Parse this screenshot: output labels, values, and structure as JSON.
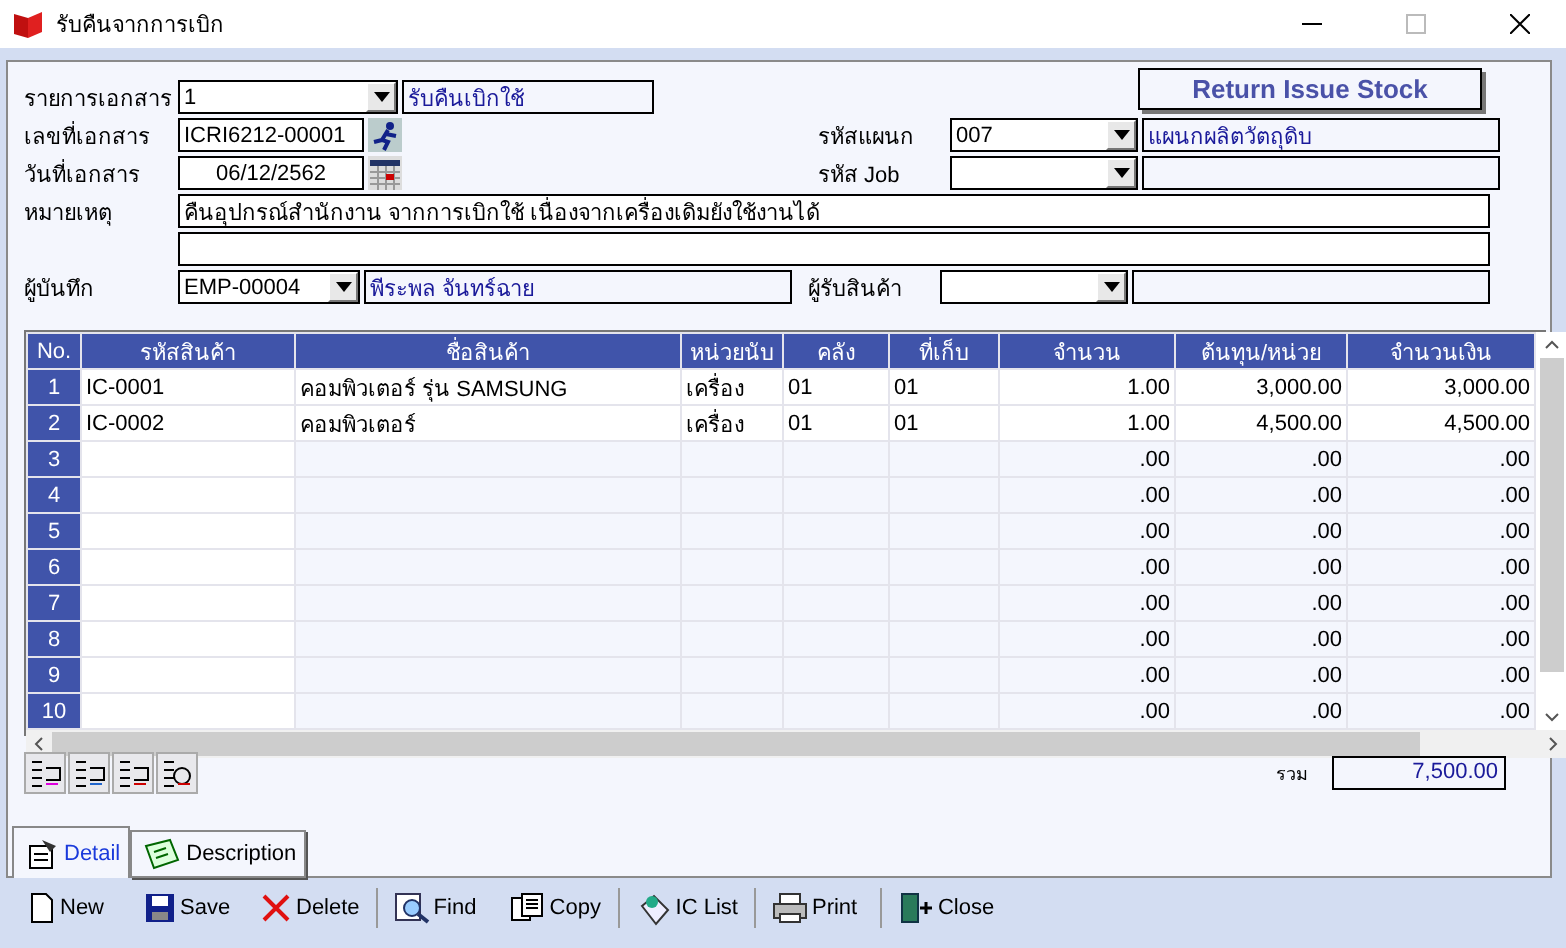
{
  "window": {
    "title": "รับคืนจากการเบิก"
  },
  "header_button": "Return Issue Stock",
  "form": {
    "doc_type": {
      "label": "รายการเอกสาร",
      "value": "1",
      "description": "รับคืนเบิกใช้"
    },
    "doc_no": {
      "label": "เลขที่เอกสาร",
      "value": "ICRI6212-00001"
    },
    "doc_date": {
      "label": "วันที่เอกสาร",
      "value": "06/12/2562"
    },
    "department": {
      "label": "รหัสแผนก",
      "value": "007",
      "description": "แผนกผลิตวัตถุดิบ"
    },
    "job": {
      "label": "รหัส Job"
    },
    "remark": {
      "label": "หมายเหตุ",
      "value": "คืนอุปกรณ์สำนักงาน จากการเบิกใช้ เนื่องจากเครื่องเดิมยังใช้งานได้"
    },
    "recorder": {
      "label": "ผู้บันทึก",
      "value": "EMP-00004",
      "description": "พีระพล จันทร์ฉาย"
    },
    "receiver": {
      "label": "ผู้รับสินค้า"
    }
  },
  "table": {
    "columns": [
      "No.",
      "รหัสสินค้า",
      "ชื่อสินค้า",
      "หน่วยนับ",
      "คลัง",
      "ที่เก็บ",
      "จำนวน",
      "ต้นทุน/หน่วย",
      "จำนวนเงิน"
    ],
    "rows": [
      {
        "no": "1",
        "code": "IC-0001",
        "name": "คอมพิวเตอร์ รุ่น SAMSUNG",
        "unit": "เครื่อง",
        "warehouse": "01",
        "location": "01",
        "qty": "1.00",
        "cost": "3,000.00",
        "amount": "3,000.00"
      },
      {
        "no": "2",
        "code": "IC-0002",
        "name": "คอมพิวเตอร์",
        "unit": "เครื่อง",
        "warehouse": "01",
        "location": "01",
        "qty": "1.00",
        "cost": "4,500.00",
        "amount": "4,500.00"
      },
      {
        "no": "3",
        "qty": ".00",
        "cost": ".00",
        "amount": ".00"
      },
      {
        "no": "4",
        "qty": ".00",
        "cost": ".00",
        "amount": ".00"
      },
      {
        "no": "5",
        "qty": ".00",
        "cost": ".00",
        "amount": ".00"
      },
      {
        "no": "6",
        "qty": ".00",
        "cost": ".00",
        "amount": ".00"
      },
      {
        "no": "7",
        "qty": ".00",
        "cost": ".00",
        "amount": ".00"
      },
      {
        "no": "8",
        "qty": ".00",
        "cost": ".00",
        "amount": ".00"
      },
      {
        "no": "9",
        "qty": ".00",
        "cost": ".00",
        "amount": ".00"
      },
      {
        "no": "10",
        "qty": ".00",
        "cost": ".00",
        "amount": ".00"
      }
    ]
  },
  "total": {
    "label": "รวม",
    "value": "7,500.00"
  },
  "tabs": [
    {
      "label": "Detail",
      "selected": true,
      "kind": "detail"
    },
    {
      "label": "Description",
      "selected": false,
      "kind": "description"
    }
  ],
  "toolbar": [
    {
      "label": "New",
      "kind": "new",
      "separator": false
    },
    {
      "label": "Save",
      "kind": "save",
      "separator": false
    },
    {
      "label": "Delete",
      "kind": "delete",
      "separator": false
    },
    {
      "label": "Find",
      "kind": "find",
      "separator": true
    },
    {
      "label": "Copy",
      "kind": "copy",
      "separator": false
    },
    {
      "label": "IC List",
      "kind": "list",
      "separator": true
    },
    {
      "label": "Print",
      "kind": "print",
      "separator": true
    },
    {
      "label": "Close",
      "kind": "close",
      "separator": true
    }
  ]
}
